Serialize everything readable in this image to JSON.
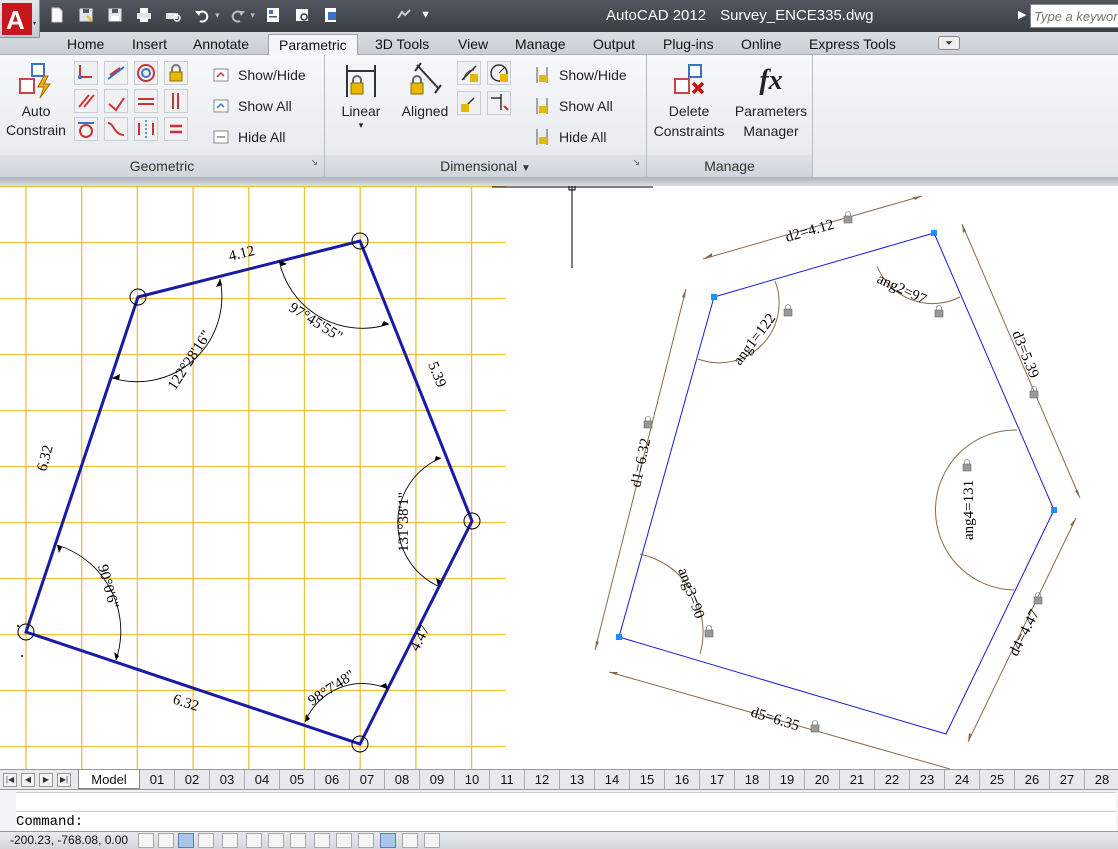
{
  "titlebar": {
    "app_name": "AutoCAD 2012",
    "file_name": "Survey_ENCE335.dwg",
    "search_placeholder": "Type a keyword",
    "logo_letter": "A"
  },
  "quick_access": [
    "new-icon",
    "save-as-icon",
    "save-icon",
    "plot-icon",
    "plot-preview-icon",
    "undo-icon",
    "redo-icon",
    "properties-icon",
    "sheet-set-icon",
    "publish-icon",
    "workspace-icon"
  ],
  "tabs": [
    {
      "label": "Home",
      "active": false
    },
    {
      "label": "Insert",
      "active": false
    },
    {
      "label": "Annotate",
      "active": false
    },
    {
      "label": "Parametric",
      "active": true
    },
    {
      "label": "3D Tools",
      "active": false
    },
    {
      "label": "View",
      "active": false
    },
    {
      "label": "Manage",
      "active": false
    },
    {
      "label": "Output",
      "active": false
    },
    {
      "label": "Plug-ins",
      "active": false
    },
    {
      "label": "Online",
      "active": false
    },
    {
      "label": "Express Tools",
      "active": false
    }
  ],
  "ribbon": {
    "geometric": {
      "title": "Geometric",
      "auto_constrain_line1": "Auto",
      "auto_constrain_line2": "Constrain",
      "show_hide": "Show/Hide",
      "show_all": "Show All",
      "hide_all": "Hide All"
    },
    "dimensional": {
      "title": "Dimensional",
      "linear": "Linear",
      "aligned": "Aligned",
      "show_hide": "Show/Hide",
      "show_all": "Show All",
      "hide_all": "Hide All"
    },
    "manage": {
      "title": "Manage",
      "delete_line1": "Delete",
      "delete_line2": "Constraints",
      "params_line1": "Parameters",
      "params_line2": "Manager",
      "fx_label": "fx"
    }
  },
  "colors": {
    "polygon": "#1a1aa8",
    "grid": "#e8c23a",
    "dimension": "#8b6a4a",
    "parametric_line": "#1a1acc",
    "grip": "#1e90ff"
  },
  "drawing_left": {
    "side_labels": [
      "4.12",
      "5.39",
      "4.47",
      "6.32",
      "6.32"
    ],
    "angle_labels": [
      "122°28'16\"",
      "97°45'55\"",
      "131°38'1\"",
      "98°7'48\"",
      "90°0'6\""
    ]
  },
  "drawing_right": {
    "params": [
      "d2=4.12",
      "ang2=97",
      "d3=5.39",
      "ang1=122",
      "d1=6.32",
      "ang4=131",
      "ang3=90",
      "d4=4.47",
      "d5=6.35"
    ]
  },
  "layout_tabs": [
    "Model",
    "01",
    "02",
    "03",
    "04",
    "05",
    "06",
    "07",
    "08",
    "09",
    "10",
    "11",
    "12",
    "13",
    "14",
    "15",
    "16",
    "17",
    "18",
    "19",
    "20",
    "21",
    "22",
    "23",
    "24",
    "25",
    "26",
    "27",
    "28"
  ],
  "command": {
    "prompt": "Command:"
  },
  "status": {
    "coordinates": "-200.23, -768.08, 0.00"
  }
}
